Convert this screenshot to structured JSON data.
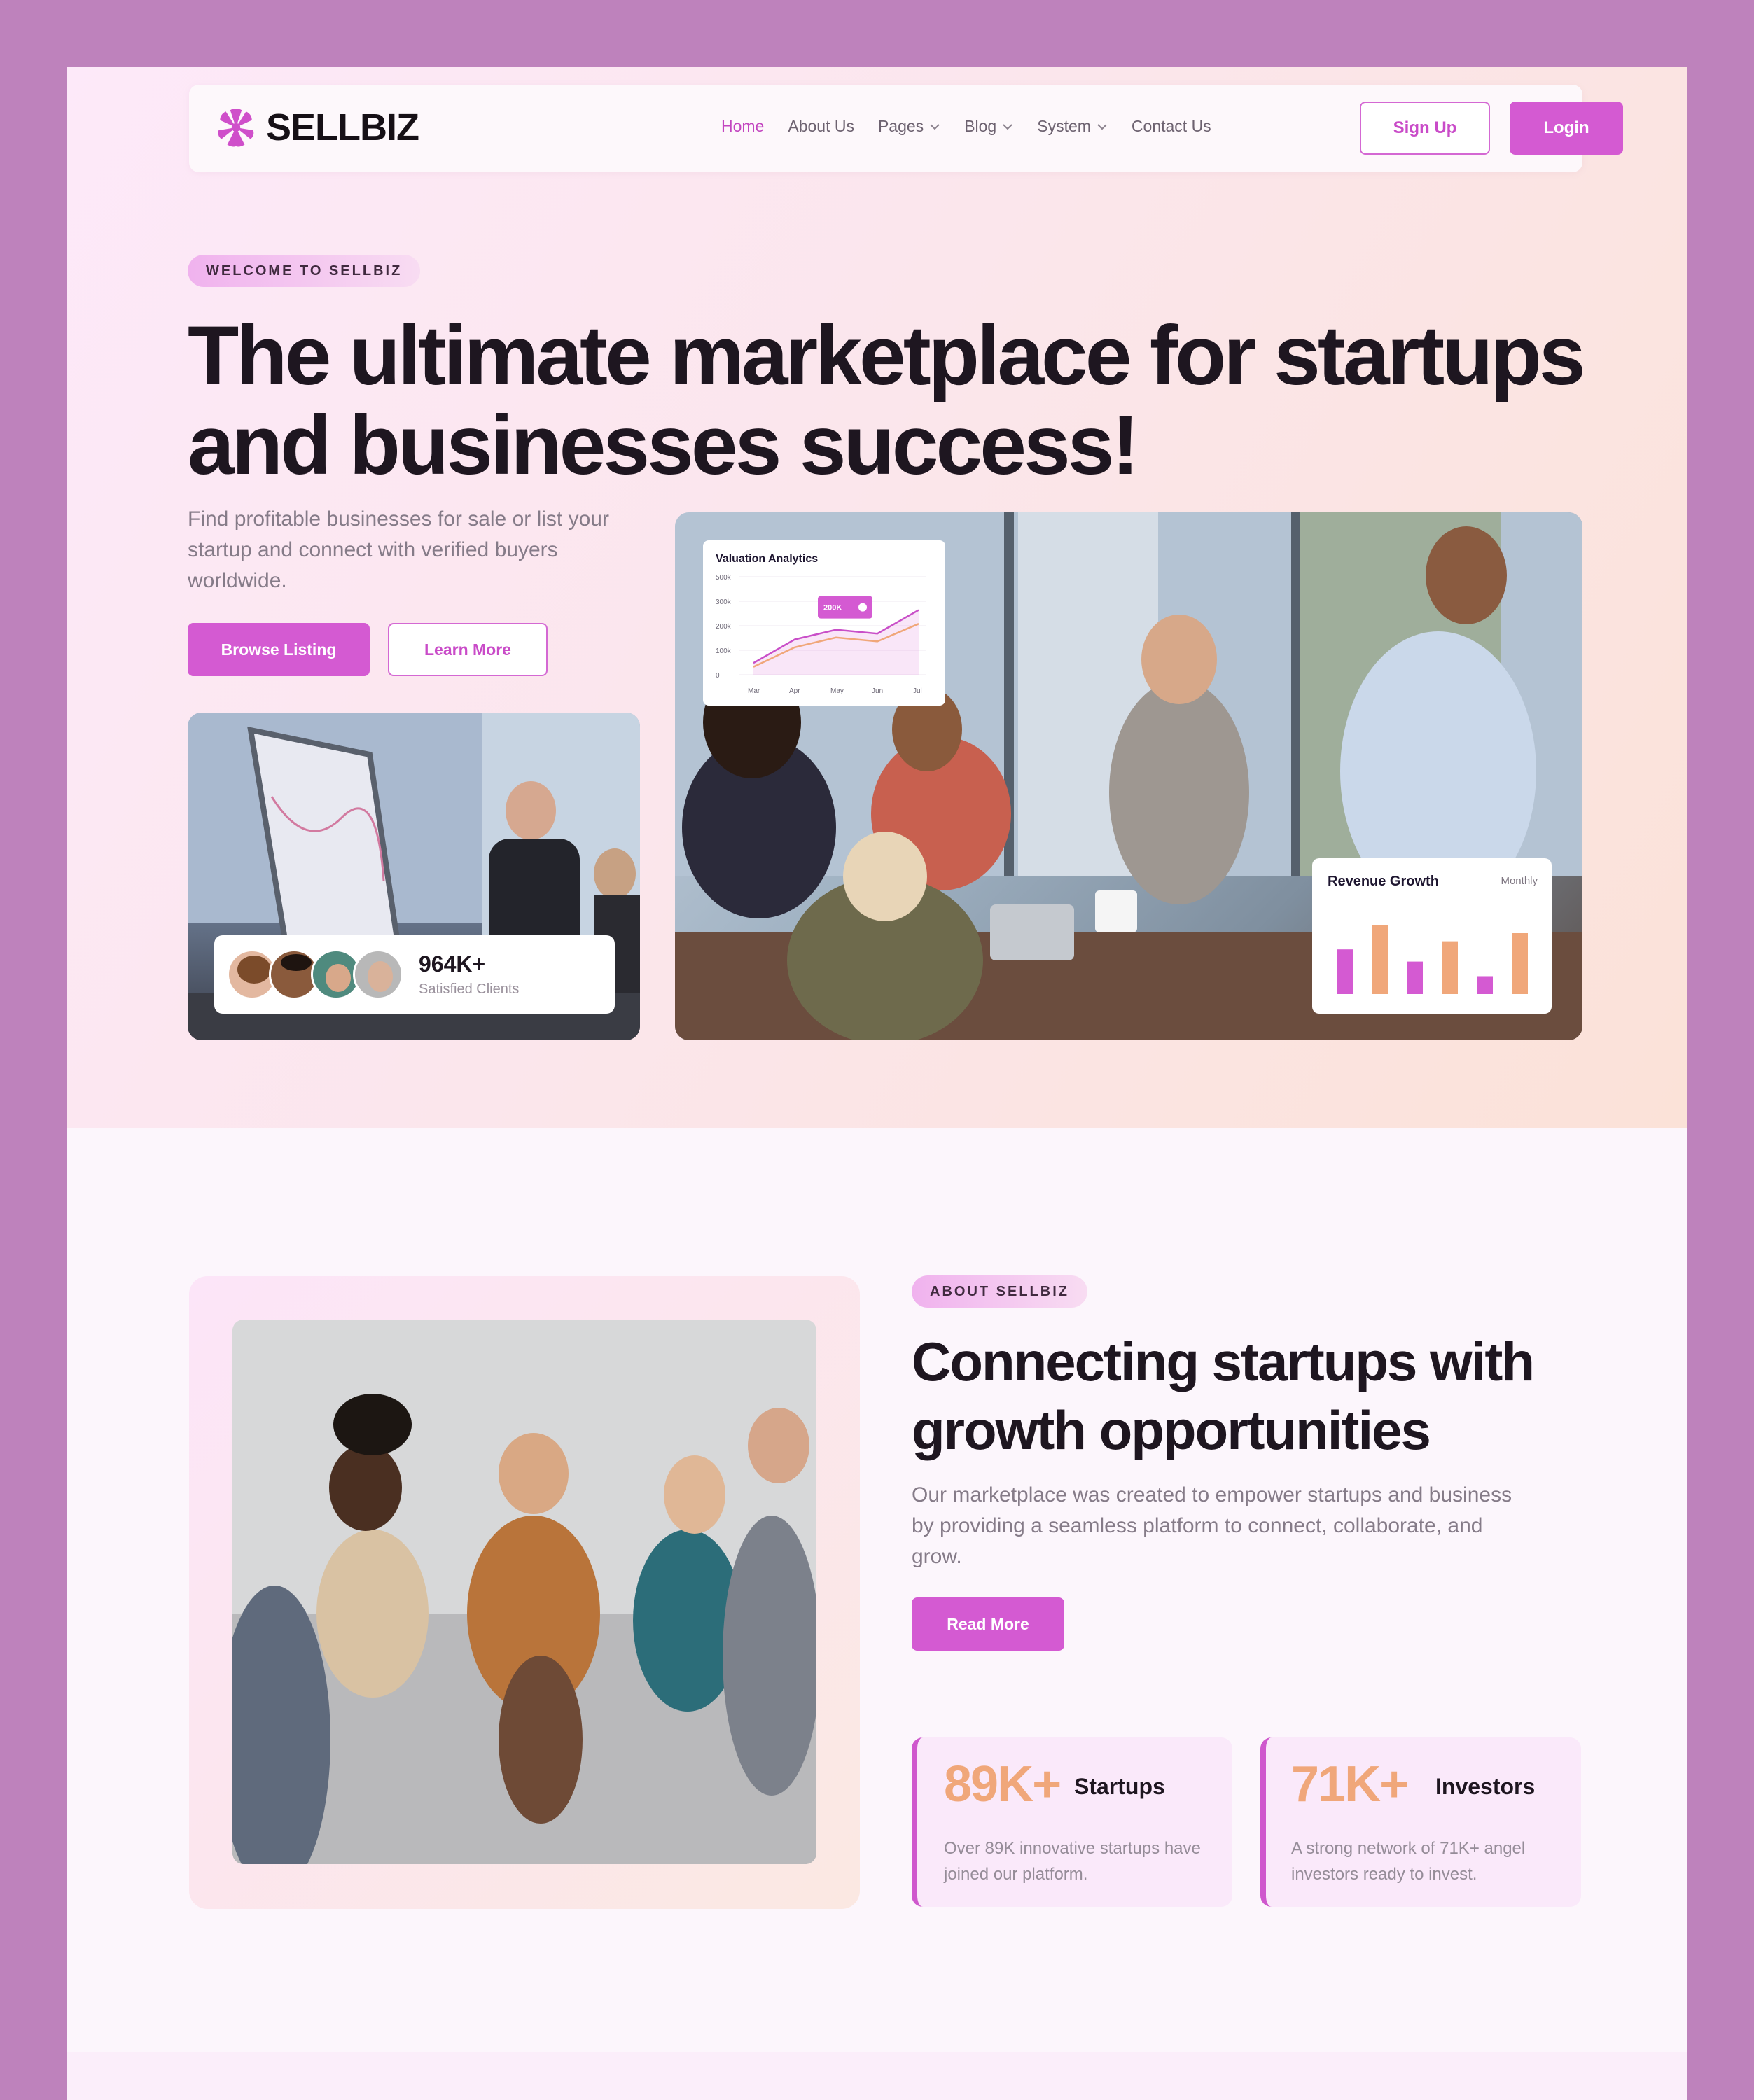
{
  "brand": {
    "name": "SELLBIZ",
    "accent": "#d45ad2",
    "orange": "#f0a77a"
  },
  "nav": {
    "items": [
      {
        "label": "Home",
        "active": true,
        "dropdown": false
      },
      {
        "label": "About Us",
        "active": false,
        "dropdown": false
      },
      {
        "label": "Pages",
        "active": false,
        "dropdown": true
      },
      {
        "label": "Blog",
        "active": false,
        "dropdown": true
      },
      {
        "label": "System",
        "active": false,
        "dropdown": true
      },
      {
        "label": "Contact Us",
        "active": false,
        "dropdown": false
      }
    ],
    "signup_label": "Sign Up",
    "login_label": "Login"
  },
  "hero": {
    "badge": "WELCOME TO SELLBIZ",
    "title_line1": "The ultimate marketplace for startups",
    "title_line2": "and businesses success!",
    "description": "Find profitable businesses for sale or list your startup and connect with verified buyers worldwide.",
    "browse_label": "Browse Listing",
    "learn_label": "Learn More",
    "clients": {
      "count": "964K+",
      "label": "Satisfied Clients"
    },
    "valuation_card": {
      "title": "Valuation Analytics",
      "y_ticks": [
        "500k",
        "300k",
        "200k",
        "100k",
        "0"
      ],
      "x_ticks": [
        "Mar",
        "Apr",
        "May",
        "Jun",
        "Jul"
      ],
      "tooltip": "200K"
    },
    "revenue_card": {
      "title": "Revenue Growth",
      "period": "Monthly"
    }
  },
  "chart_data": [
    {
      "type": "line",
      "title": "Valuation Analytics",
      "x": [
        "Mar",
        "Apr",
        "May",
        "Jun",
        "Jul"
      ],
      "y_ticks": [
        "500k",
        "300k",
        "200k",
        "100k",
        "0"
      ],
      "series": [
        {
          "values": [
            60,
            180,
            230,
            210,
            330
          ]
        },
        {
          "values": [
            40,
            140,
            190,
            170,
            260
          ]
        }
      ]
    },
    {
      "type": "bar",
      "title": "Revenue Growth",
      "subtitle": "Monthly",
      "values": [
        55,
        85,
        40,
        65,
        22,
        75
      ],
      "colors": [
        "#d45ad2",
        "#f0a77a",
        "#d45ad2",
        "#f0a77a",
        "#d45ad2",
        "#f0a77a"
      ]
    }
  ],
  "about": {
    "badge": "ABOUT SELLBIZ",
    "title_line1": "Connecting startups with",
    "title_line2": "growth opportunities",
    "description": "Our marketplace was created to empower startups and business by providing a seamless platform to connect, collaborate, and grow.",
    "read_more_label": "Read More",
    "stats": [
      {
        "number": "89K+",
        "label": "Startups",
        "desc": "Over 89K innovative startups have joined our platform."
      },
      {
        "number": "71K+",
        "label": "Investors",
        "desc": "A strong network of 71K+ angel investors ready to invest."
      }
    ]
  }
}
